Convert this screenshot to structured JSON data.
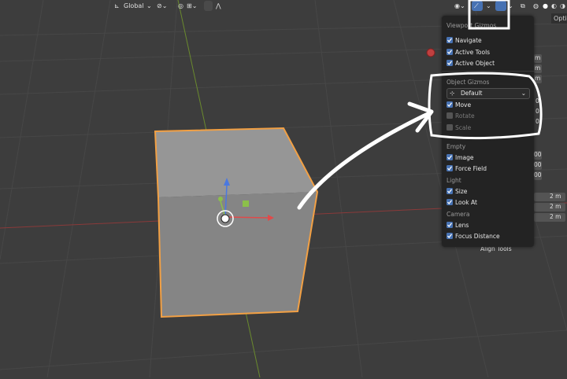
{
  "topbar": {
    "transform_orientation": "Global",
    "options_tab": "Optio"
  },
  "gizmo_panel": {
    "title": "Viewport Gizmos",
    "viewport_items": [
      {
        "label": "Navigate",
        "checked": true
      },
      {
        "label": "Active Tools",
        "checked": true
      },
      {
        "label": "Active Object",
        "checked": true
      }
    ],
    "object_gizmos": {
      "header": "Object Gizmos",
      "orientation": "Default",
      "items": [
        {
          "label": "Move",
          "checked": true,
          "enabled": true
        },
        {
          "label": "Rotate",
          "checked": false,
          "enabled": false
        },
        {
          "label": "Scale",
          "checked": false,
          "enabled": false
        }
      ]
    },
    "empty": {
      "header": "Empty",
      "items": [
        {
          "label": "Image",
          "checked": true
        },
        {
          "label": "Force Field",
          "checked": true
        }
      ]
    },
    "light": {
      "header": "Light",
      "items": [
        {
          "label": "Size",
          "checked": true
        },
        {
          "label": "Look At",
          "checked": true
        }
      ]
    },
    "camera": {
      "header": "Camera",
      "items": [
        {
          "label": "Lens",
          "checked": true
        },
        {
          "label": "Focus Distance",
          "checked": true
        }
      ]
    }
  },
  "right_sidebar": {
    "fields": [
      {
        "text": "m"
      },
      {
        "text": "m"
      },
      {
        "text": "m"
      },
      {
        "text": "0"
      },
      {
        "text": "0"
      },
      {
        "text": "0"
      },
      {
        "text": "00"
      },
      {
        "text": "00"
      },
      {
        "text": "00"
      },
      {
        "text": "2 m"
      },
      {
        "text": "2 m"
      },
      {
        "text": "2 m"
      }
    ],
    "align_tools": "Align Tools"
  }
}
